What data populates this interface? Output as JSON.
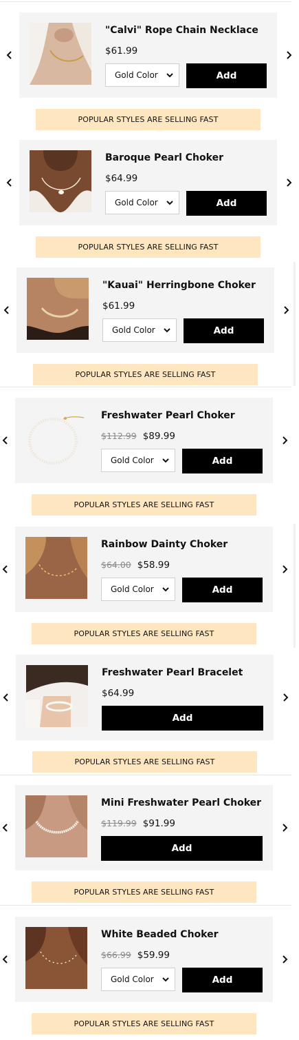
{
  "colors": {
    "card_bg": "#f4f4f4",
    "banner_bg": "#fde6c0",
    "button_bg": "#000000",
    "button_text": "#ffffff",
    "old_price": "#8a8a8a"
  },
  "icons": {
    "prev": "chevron-left-icon",
    "next": "chevron-right-icon",
    "select": "chevron-down-icon"
  },
  "banner_text": "POPULAR STYLES ARE SELLING FAST",
  "products": [
    {
      "title": "\"Calvi\" Rope Chain Necklace",
      "price": "$61.99",
      "option": "Gold Color",
      "add": "Add"
    },
    {
      "title": "Baroque Pearl Choker",
      "price": "$64.99",
      "option": "Gold Color",
      "add": "Add"
    },
    {
      "title": "\"Kauai\" Herringbone Choker",
      "price": "$61.99",
      "option": "Gold Color",
      "add": "Add"
    },
    {
      "title": "Freshwater Pearl Choker",
      "old_price": "$112.99",
      "price": "$89.99",
      "option": "Gold Color",
      "add": "Add"
    },
    {
      "title": "Rainbow Dainty Choker",
      "old_price": "$64.00",
      "price": "$58.99",
      "option": "Gold Color",
      "add": "Add"
    },
    {
      "title": "Freshwater Pearl Bracelet",
      "price": "$64.99",
      "add": "Add"
    },
    {
      "title": "Mini Freshwater Pearl Choker",
      "old_price": "$119.99",
      "price": "$91.99",
      "add": "Add"
    },
    {
      "title": "White Beaded Choker",
      "old_price": "$66.99",
      "price": "$59.99",
      "option": "Gold Color",
      "add": "Add"
    }
  ]
}
